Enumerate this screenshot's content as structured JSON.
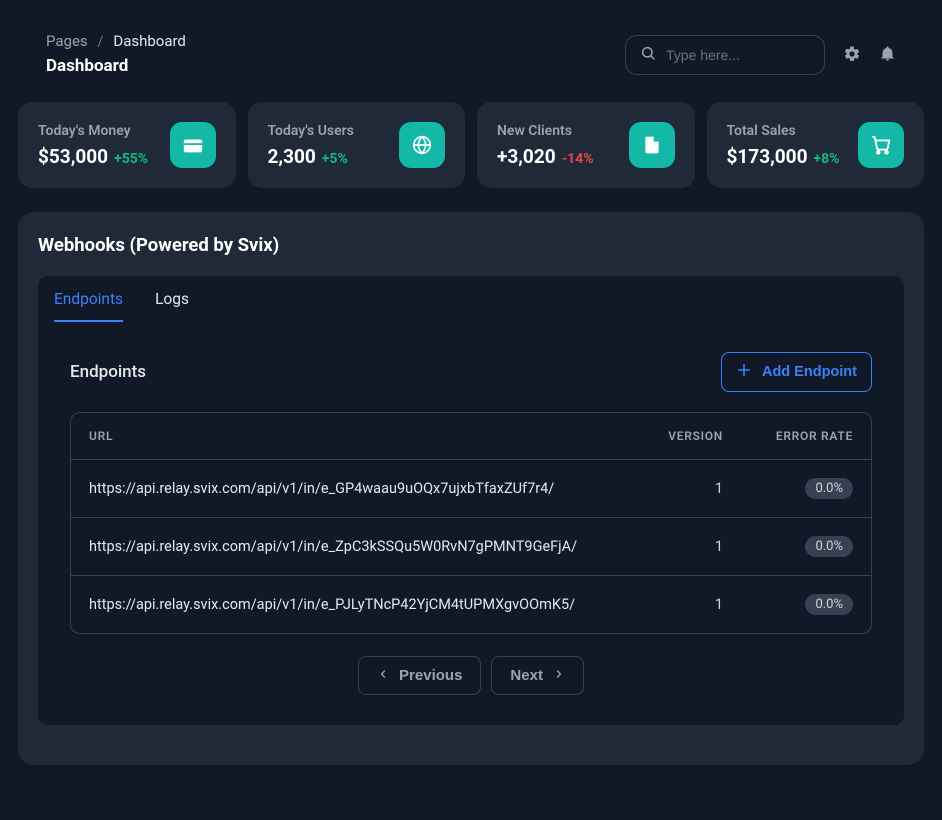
{
  "breadcrumb": {
    "root": "Pages",
    "current": "Dashboard"
  },
  "pageTitle": "Dashboard",
  "search": {
    "placeholder": "Type here..."
  },
  "stats": [
    {
      "label": "Today's Money",
      "value": "$53,000",
      "delta": "+55%",
      "deltaDir": "up",
      "icon": "wallet"
    },
    {
      "label": "Today's Users",
      "value": "2,300",
      "delta": "+5%",
      "deltaDir": "up",
      "icon": "globe"
    },
    {
      "label": "New Clients",
      "value": "+3,020",
      "delta": "-14%",
      "deltaDir": "down",
      "icon": "document"
    },
    {
      "label": "Total Sales",
      "value": "$173,000",
      "delta": "+8%",
      "deltaDir": "up",
      "icon": "cart"
    }
  ],
  "webhooks": {
    "title": "Webhooks (Powered by Svix)",
    "tabs": {
      "endpoints": "Endpoints",
      "logs": "Logs"
    },
    "activeTab": "endpoints",
    "endpointsSection": {
      "heading": "Endpoints",
      "addButton": "Add Endpoint",
      "columns": {
        "url": "URL",
        "version": "VERSION",
        "errorRate": "ERROR RATE"
      },
      "rows": [
        {
          "url": "https://api.relay.svix.com/api/v1/in/e_GP4waau9uOQx7ujxbTfaxZUf7r4/",
          "version": "1",
          "errorRate": "0.0%"
        },
        {
          "url": "https://api.relay.svix.com/api/v1/in/e_ZpC3kSSQu5W0RvN7gPMNT9GeFjA/",
          "version": "1",
          "errorRate": "0.0%"
        },
        {
          "url": "https://api.relay.svix.com/api/v1/in/e_PJLyTNcP42YjCM4tUPMXgvOOmK5/",
          "version": "1",
          "errorRate": "0.0%"
        }
      ],
      "pagination": {
        "previous": "Previous",
        "next": "Next"
      }
    }
  },
  "colors": {
    "accent": "#14b8a6",
    "link": "#3b82f6",
    "bg": "#111827",
    "panel": "#1f2937",
    "positive": "#10b981",
    "negative": "#ef4444"
  }
}
